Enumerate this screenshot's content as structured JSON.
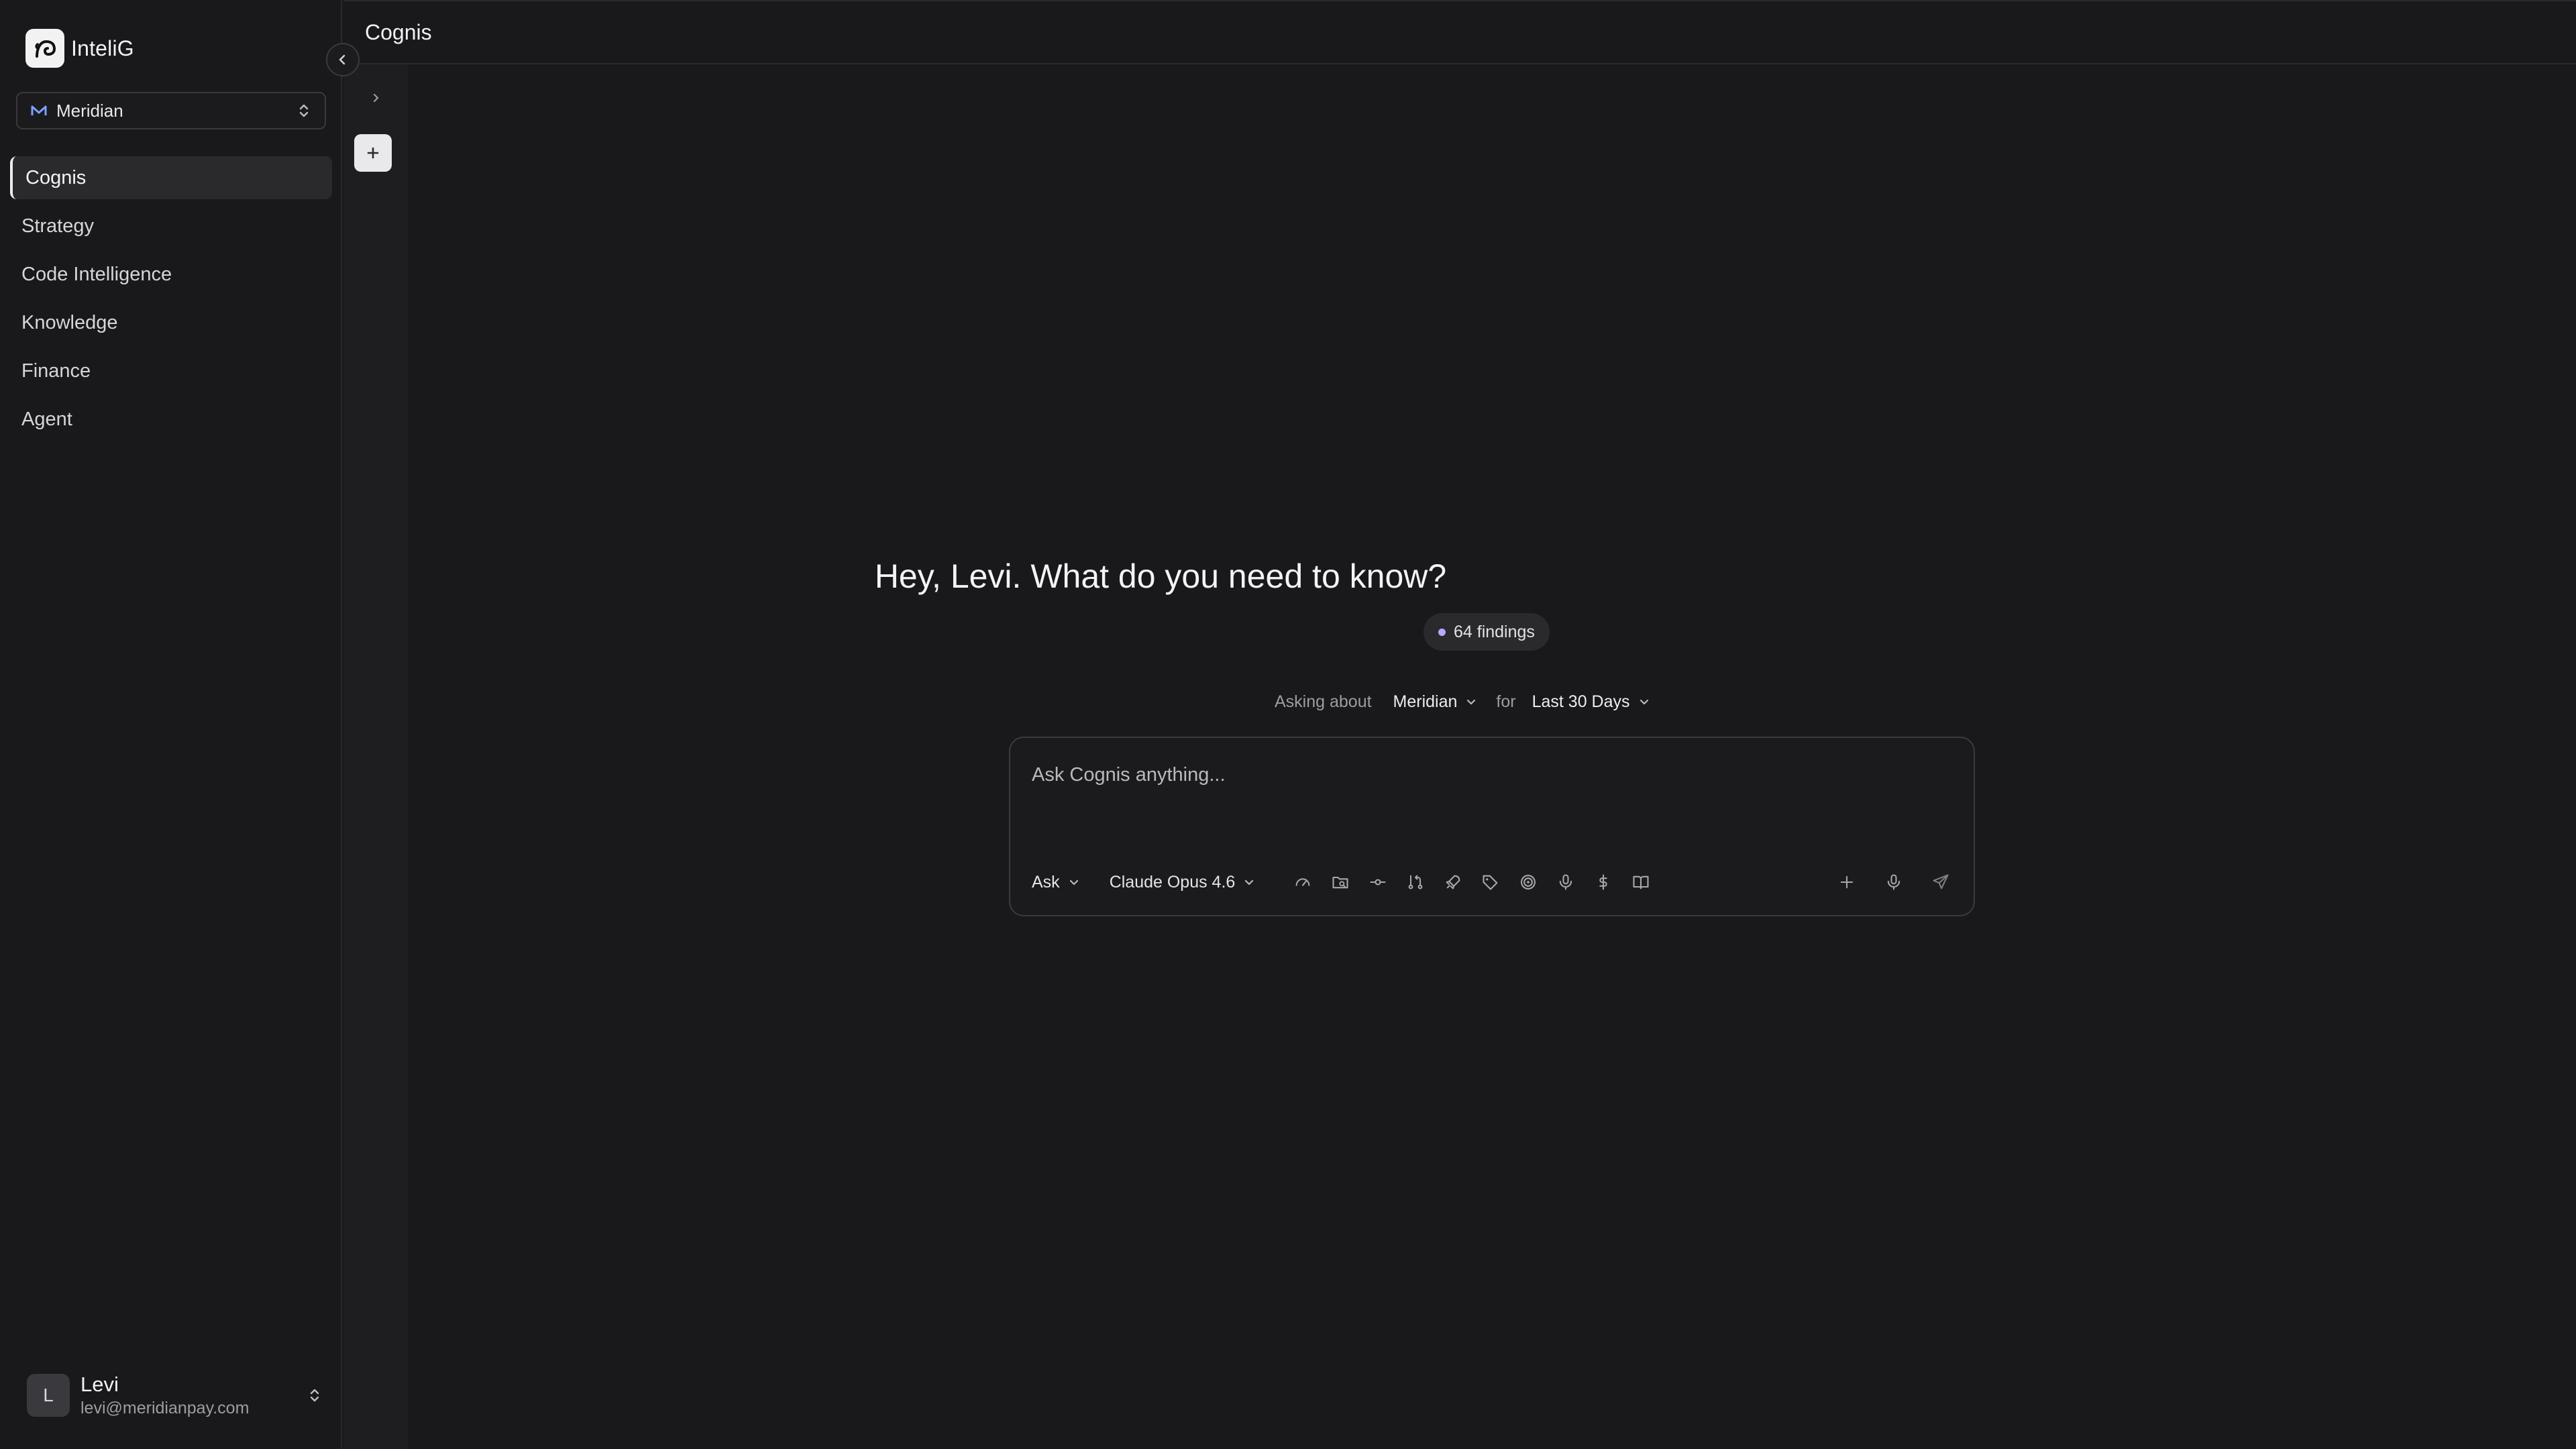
{
  "app": {
    "name": "InteliG"
  },
  "org_select": {
    "value": "Meridian"
  },
  "nav": {
    "items": [
      {
        "label": "Cognis"
      },
      {
        "label": "Strategy"
      },
      {
        "label": "Code Intelligence"
      },
      {
        "label": "Knowledge"
      },
      {
        "label": "Finance"
      },
      {
        "label": "Agent"
      }
    ],
    "active": "Cognis"
  },
  "user": {
    "initial": "L",
    "name": "Levi",
    "email": "levi@meridianpay.com"
  },
  "header": {
    "title": "Cognis"
  },
  "main": {
    "greeting": "Hey, Levi. What do you need to know?",
    "findings": "64 findings",
    "context": {
      "asking_about_label": "Asking about",
      "asking_about_value": "Meridian",
      "for_label": "for",
      "period_value": "Last 30 Days"
    }
  },
  "composer": {
    "placeholder": "Ask Cognis anything...",
    "mode": "Ask",
    "model": "Claude Opus 4.6"
  },
  "colors": {
    "background": "#19191b",
    "rail": "#1e1e21",
    "border": "#2a2a2d",
    "findings_dot": "#b9a8ff",
    "org_icon": "#7aa2ff"
  },
  "icons": {
    "tools": [
      "gauge-icon",
      "folder-search-icon",
      "commit-icon",
      "pull-request-icon",
      "rocket-icon",
      "tag-icon",
      "target-icon",
      "microphone-icon",
      "dollar-icon",
      "book-icon"
    ],
    "right": [
      "plus-icon",
      "microphone-icon",
      "send-icon"
    ]
  }
}
